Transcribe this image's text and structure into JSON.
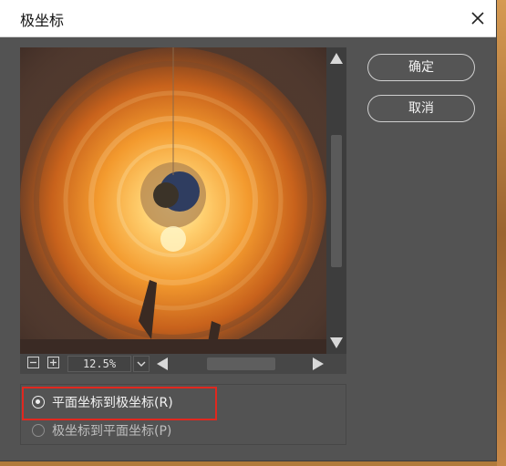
{
  "window": {
    "title": "极坐标"
  },
  "buttons": {
    "ok": "确定",
    "cancel": "取消"
  },
  "zoom": {
    "value": "12.5%"
  },
  "options": [
    {
      "label": "平面坐标到极坐标(R)",
      "selected": true
    },
    {
      "label": "极坐标到平面坐标(P)",
      "selected": false
    }
  ],
  "colors": {
    "highlight": "#e0281f",
    "dialog_bg": "#535353",
    "accent_orange": "#f0a23c"
  }
}
